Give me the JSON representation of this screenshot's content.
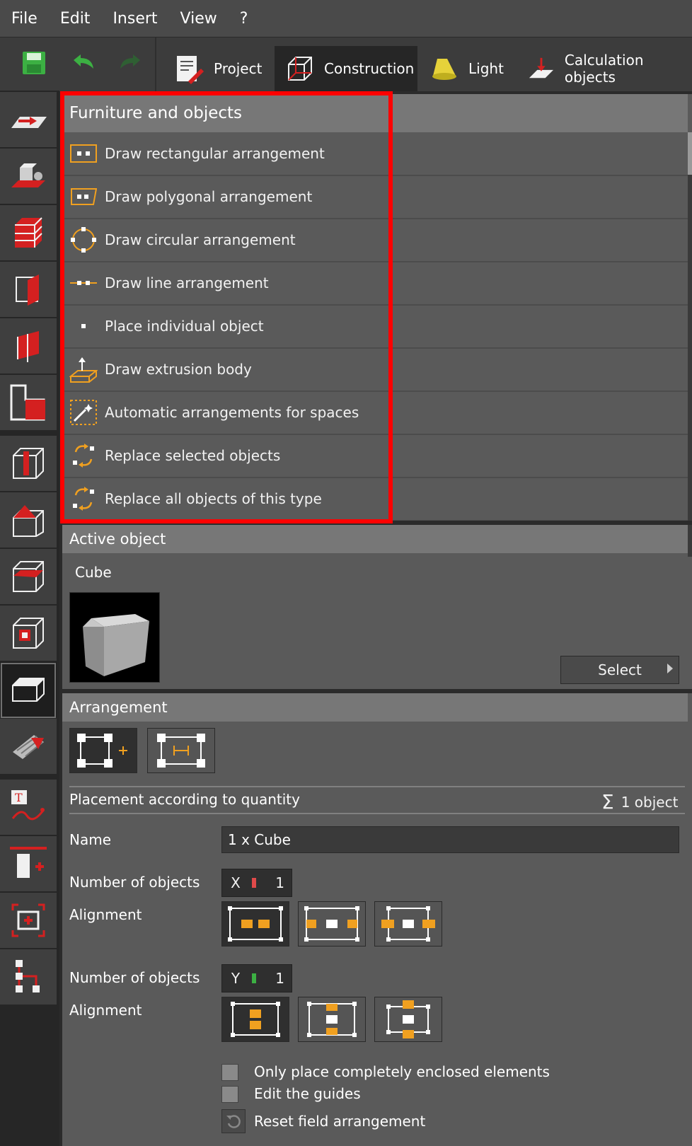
{
  "menu": {
    "items": [
      "File",
      "Edit",
      "Insert",
      "View",
      "?"
    ]
  },
  "tabs": [
    {
      "label": "Project",
      "active": false
    },
    {
      "label": "Construction",
      "active": true
    },
    {
      "label": "Light",
      "active": false
    },
    {
      "label": "Calculation objects",
      "active": false
    }
  ],
  "furniture": {
    "title": "Furniture and objects",
    "items": [
      {
        "label": "Draw rectangular arrangement",
        "icon": "rectangular-arrangement-icon"
      },
      {
        "label": "Draw polygonal arrangement",
        "icon": "polygonal-arrangement-icon"
      },
      {
        "label": "Draw circular arrangement",
        "icon": "circular-arrangement-icon"
      },
      {
        "label": "Draw line arrangement",
        "icon": "line-arrangement-icon"
      },
      {
        "label": "Place individual object",
        "icon": "individual-object-icon"
      },
      {
        "label": "Draw extrusion body",
        "icon": "extrusion-body-icon"
      },
      {
        "label": "Automatic arrangements for spaces",
        "icon": "magic-wand-icon"
      },
      {
        "label": "Replace selected objects",
        "icon": "replace-icon"
      },
      {
        "label": "Replace all objects of this type",
        "icon": "replace-all-icon"
      }
    ]
  },
  "active_object": {
    "title": "Active object",
    "name": "Cube",
    "select_label": "Select"
  },
  "arrangement": {
    "title": "Arrangement",
    "placement_label": "Placement according to quantity",
    "count_label": "1 object",
    "name_label": "Name",
    "name_value": "1 x Cube",
    "x": {
      "label": "Number of objects",
      "axis": "X",
      "value": "1"
    },
    "y": {
      "label": "Number of objects",
      "axis": "Y",
      "value": "1"
    },
    "alignment_label": "Alignment",
    "options": {
      "enclosed": "Only place completely enclosed elements",
      "edit_guides": "Edit the guides",
      "reset": "Reset field arrangement"
    }
  },
  "colors": {
    "accent": "#f0a020",
    "highlight": "#ff0000",
    "brand_red": "#d42020",
    "green": "#3cb043"
  }
}
